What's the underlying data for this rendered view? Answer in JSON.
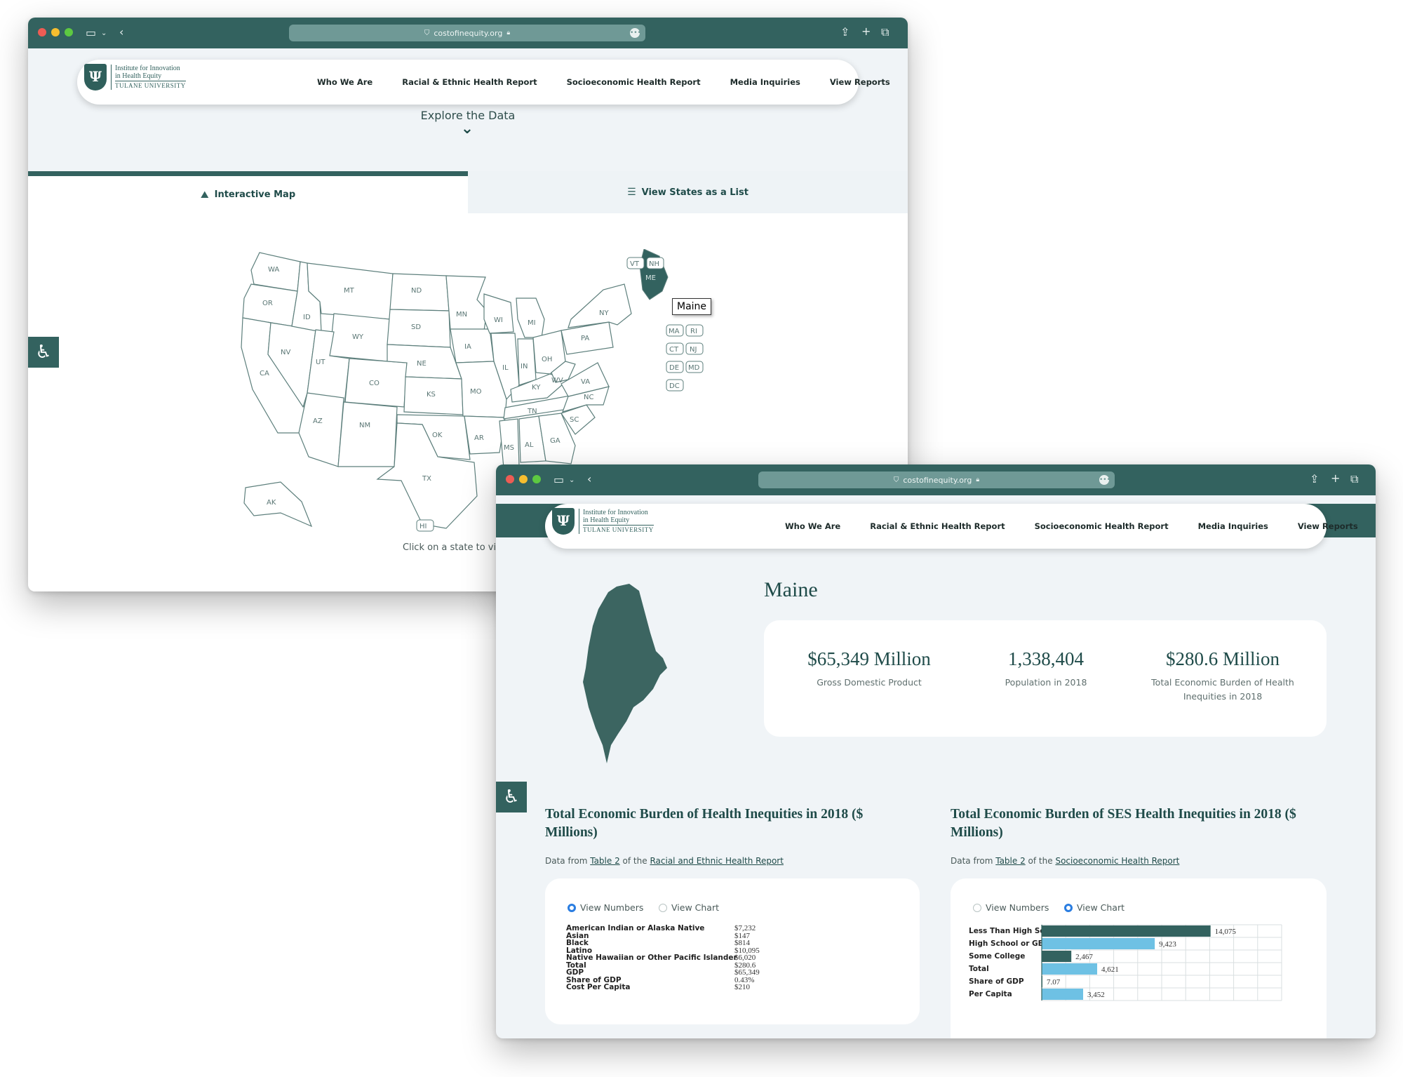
{
  "browser": {
    "url": "costofinequity.org"
  },
  "logo": {
    "line1": "Institute for Innovation",
    "line2": "in Health Equity",
    "line3": "TULANE UNIVERSITY",
    "monogram": "Ψ"
  },
  "nav": {
    "items": [
      "Who We Are",
      "Racial & Ethnic Health Report",
      "Socioeconomic Health Report",
      "Media Inquiries",
      "View Reports"
    ]
  },
  "map_window": {
    "explore_label": "Explore the Data",
    "tabs": [
      {
        "label": "Interactive Map",
        "active": true
      },
      {
        "label": "View States as a List",
        "active": false
      }
    ],
    "hint": "Click on a state to view",
    "tooltip": "Maine",
    "state_labels": [
      "WA",
      "OR",
      "CA",
      "NV",
      "ID",
      "MT",
      "WY",
      "UT",
      "CO",
      "AZ",
      "NM",
      "ND",
      "SD",
      "NE",
      "KS",
      "OK",
      "TX",
      "MN",
      "IA",
      "MO",
      "AR",
      "WI",
      "IL",
      "MI",
      "IN",
      "OH",
      "KY",
      "TN",
      "MS",
      "AL",
      "GA",
      "SC",
      "NC",
      "VA",
      "WV",
      "PA",
      "NY",
      "ME",
      "AK",
      "HI"
    ],
    "small_states": [
      "VT",
      "NH",
      "MA",
      "RI",
      "CT",
      "NJ",
      "DE",
      "MD",
      "DC"
    ],
    "highlight_color": "#33625f"
  },
  "detail_window": {
    "state_name": "Maine",
    "stats": [
      {
        "value": "$65,349 Million",
        "label": "Gross Domestic Product"
      },
      {
        "value": "1,338,404",
        "label": "Population in 2018"
      },
      {
        "value": "$280.6 Million",
        "label": "Total Economic Burden of Health Inequities in 2018"
      }
    ],
    "left_section": {
      "title": "Total Economic Burden of Health Inequities in 2018 ($ Millions)",
      "src_prefix": "Data from",
      "src_table": "Table 2",
      "src_mid": "of the",
      "src_report": "Racial and Ethnic Health Report",
      "radio_numbers": "View Numbers",
      "radio_chart": "View Chart",
      "rows": [
        {
          "label": "American Indian or Alaska Native",
          "value": "$7,232"
        },
        {
          "label": "Asian",
          "value": "$147"
        },
        {
          "label": "Black",
          "value": "$814"
        },
        {
          "label": "Latino",
          "value": "$10,095"
        },
        {
          "label": "Native Hawaiian or Other Pacific Islander",
          "value": "$6,020"
        },
        {
          "label": "Total",
          "value": "$280.6"
        },
        {
          "label": "GDP",
          "value": "$65,349"
        },
        {
          "label": "Share of GDP",
          "value": "0.43%"
        },
        {
          "label": "Cost Per Capita",
          "value": "$210"
        }
      ]
    },
    "right_section": {
      "title": "Total Economic Burden of SES Health Inequities in 2018 ($ Millions)",
      "src_prefix": "Data from",
      "src_table": "Table 2",
      "src_mid": "of the",
      "src_report": "Socioeconomic Health Report",
      "radio_numbers": "View Numbers",
      "radio_chart": "View Chart"
    }
  },
  "chart_data": {
    "type": "bar",
    "orientation": "horizontal",
    "categories": [
      "Less Than High School",
      "High School or GED",
      "Some College",
      "Total",
      "Share of GDP",
      "Per Capita"
    ],
    "values": [
      14075,
      9423,
      2467,
      4621,
      7.07,
      3452
    ],
    "value_labels": [
      "14,075",
      "9,423",
      "2,467",
      "4,621",
      "7.07",
      "3,452"
    ],
    "bar_colors": [
      "#33625f",
      "#6ec1e4",
      "#33625f",
      "#6ec1e4",
      "#33625f",
      "#6ec1e4"
    ],
    "xlim": [
      0,
      20000
    ],
    "grid": true
  },
  "colors": {
    "brand": "#33625f",
    "light_bar": "#6ec1e4",
    "radio_active": "#2a7de1"
  }
}
